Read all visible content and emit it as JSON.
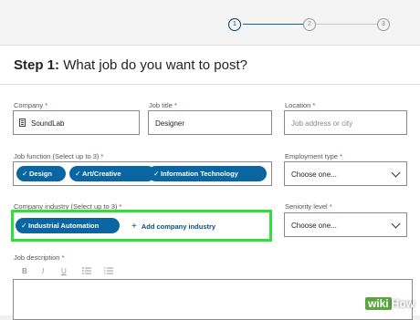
{
  "stepper": {
    "steps": [
      "1",
      "2",
      "3"
    ],
    "active": 1
  },
  "step_title": {
    "prefix": "Step 1:",
    "question": "What job do you want to post?"
  },
  "required_mark": "*",
  "company": {
    "label": "Company",
    "value": "SoundLab",
    "icon": "building-icon"
  },
  "job_title": {
    "label": "Job title",
    "value": "Designer"
  },
  "location": {
    "label": "Location",
    "placeholder": "Job address or city"
  },
  "job_function": {
    "label": "Job function (Select up to 3)",
    "tags": [
      "Design",
      "Art/Creative",
      "Information Technology"
    ]
  },
  "employment_type": {
    "label": "Employment type",
    "value": "Choose one..."
  },
  "company_industry": {
    "label": "Company industry (Select up to 3)",
    "tags": [
      "Industrial Automation"
    ],
    "add_label": "Add company industry"
  },
  "seniority_level": {
    "label": "Seniority level",
    "value": "Choose one..."
  },
  "job_description": {
    "label": "Job description",
    "toolbar": [
      "B",
      "I",
      "U",
      "list-icon",
      "numbered-list-icon"
    ]
  },
  "watermark": {
    "brand_left": "wiki",
    "brand_right": "How"
  },
  "colors": {
    "accent": "#0a66a0",
    "highlight": "#2ee03a"
  }
}
